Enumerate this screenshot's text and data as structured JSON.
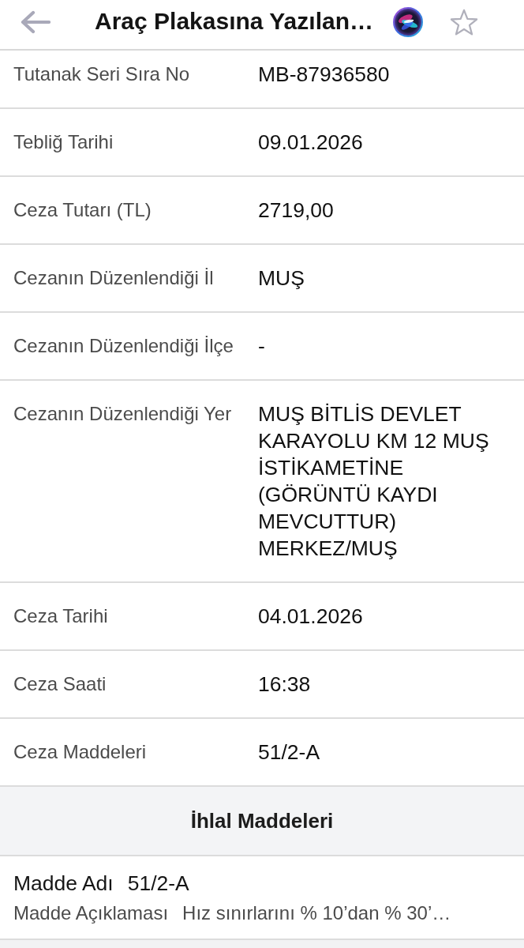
{
  "header": {
    "title": "Araç Plakasına Yazılan…"
  },
  "details": [
    {
      "label": "Tutanak Seri Sıra No",
      "value": "MB-87936580"
    },
    {
      "label": "Tebliğ Tarihi",
      "value": "09.01.2026"
    },
    {
      "label": "Ceza Tutarı (TL)",
      "value": "2719,00"
    },
    {
      "label": "Cezanın Düzenlendiği İl",
      "value": "MUŞ"
    },
    {
      "label": "Cezanın Düzenlendiği İlçe",
      "value": "-"
    },
    {
      "label": "Cezanın Düzenlendiği Yer",
      "value": "MUŞ BİTLİS DEVLET KARAYOLU KM 12 MUŞ İSTİKAMETİNE (GÖRÜNTÜ KAYDI MEVCUTTUR) MERKEZ/MUŞ"
    },
    {
      "label": "Ceza Tarihi",
      "value": "04.01.2026"
    },
    {
      "label": "Ceza Saati",
      "value": "16:38"
    },
    {
      "label": "Ceza Maddeleri",
      "value": "51/2-A"
    }
  ],
  "section": {
    "title": "İhlal Maddeleri"
  },
  "articles": [
    {
      "name_label": "Madde Adı",
      "name": "51/2-A",
      "description_label": "Madde Açıklaması",
      "description": "Hız sınırlarını % 10’dan % 30’…"
    }
  ]
}
